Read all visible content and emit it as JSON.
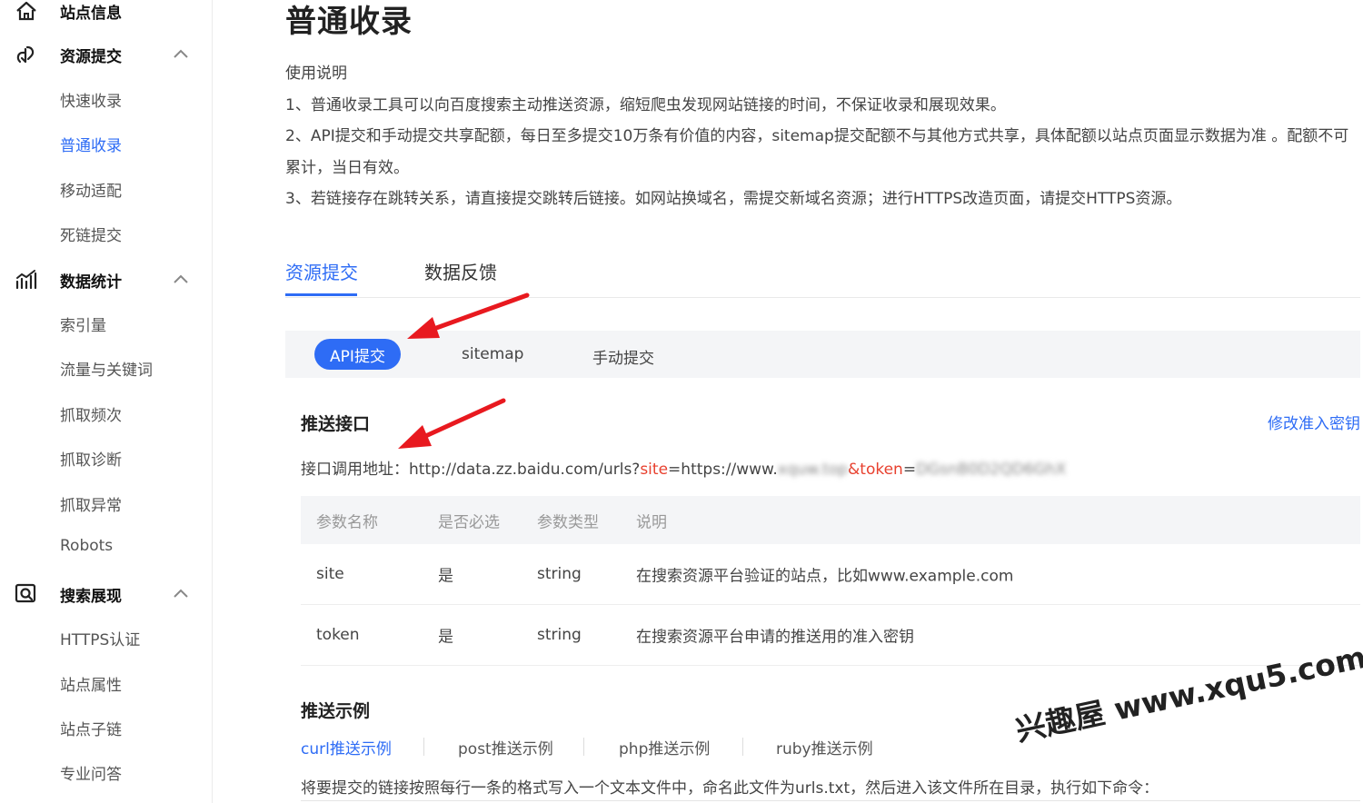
{
  "sidebar": {
    "groups": [
      {
        "label": "站点信息",
        "icon": "home-icon",
        "items": []
      },
      {
        "label": "资源提交",
        "icon": "upload-link-icon",
        "items": [
          "快速收录",
          "普通收录",
          "移动适配",
          "死链提交"
        ]
      },
      {
        "label": "数据统计",
        "icon": "chart-icon",
        "items": [
          "索引量",
          "流量与关键词",
          "抓取频次",
          "抓取诊断",
          "抓取异常",
          "Robots"
        ]
      },
      {
        "label": "搜索展现",
        "icon": "search-display-icon",
        "items": [
          "HTTPS认证",
          "站点属性",
          "站点子链",
          "专业问答"
        ]
      }
    ],
    "active_item": "普通收录"
  },
  "page": {
    "title": "普通收录",
    "instructions": {
      "heading": "使用说明",
      "line1": "1、普通收录工具可以向百度搜索主动推送资源，缩短爬虫发现网站链接的时间，不保证收录和展现效果。",
      "line2": "2、API提交和手动提交共享配额，每日至多提交10万条有价值的内容，sitemap提交配额不与其他方式共享，具体配额以站点页面显示数据为准 。配额不可",
      "line2_cont": "累计，当日有效。",
      "line3": "3、若链接存在跳转关系，请直接提交跳转后链接。如网站换域名，需提交新域名资源；进行HTTPS改造页面，请提交HTTPS资源。"
    },
    "tabs": [
      "资源提交",
      "数据反馈"
    ],
    "subtabs": [
      "API提交",
      "sitemap",
      "手动提交"
    ],
    "push_api": {
      "title": "推送接口",
      "edit_link": "修改准入密钥",
      "url_label": "接口调用地址：",
      "url_prefix": "http://data.zz.baidu.com/urls?",
      "site_key": "site",
      "site_eq": "=https://www.",
      "site_blurred": "xquw.top",
      "token_key": "&token",
      "token_eq": "=",
      "token_blurred": "DGsnB0D2QD6GhX"
    },
    "param_table": {
      "headers": [
        "参数名称",
        "是否必选",
        "参数类型",
        "说明"
      ],
      "rows": [
        [
          "site",
          "是",
          "string",
          "在搜索资源平台验证的站点，比如www.example.com"
        ],
        [
          "token",
          "是",
          "string",
          "在搜索资源平台申请的推送用的准入密钥"
        ]
      ]
    },
    "examples": {
      "title": "推送示例",
      "tabs": [
        "curl推送示例",
        "post推送示例",
        "php推送示例",
        "ruby推送示例"
      ],
      "desc": "将要提交的链接按照每行一条的格式写入一个文本文件中，命名此文件为urls.txt，然后进入该文件所在目录，执行如下命令："
    }
  },
  "watermark": "兴趣屋 www.xqu5.com",
  "colors": {
    "accent": "#2e6cf5",
    "arrow": "#e8191f",
    "param_highlight": "#e8412f"
  }
}
